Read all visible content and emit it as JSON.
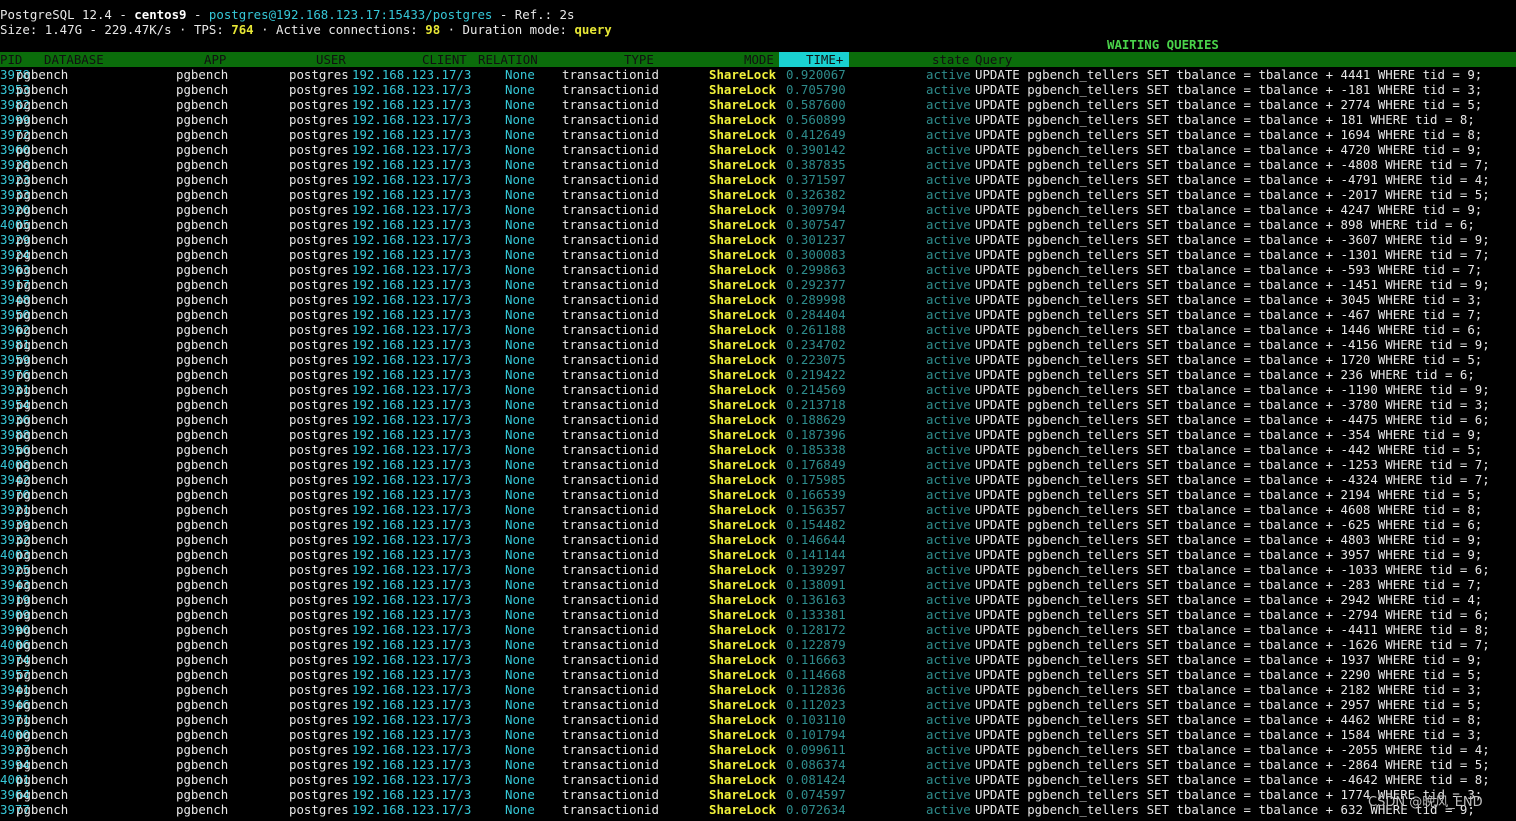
{
  "status": {
    "line1": {
      "version": "PostgreSQL 12.4",
      "sep1": " - ",
      "host": "centos9",
      "sep2": " - ",
      "conn": "postgres@192.168.123.17:15433/postgres",
      "sep3": " - ",
      "refresh": "Ref.: 2s"
    },
    "line2": {
      "size": "Size: 1.47G - 229.47K/s · TPS: ",
      "tps": "764",
      "active_lbl": " · Active connections: ",
      "active": "98",
      "dur_lbl": " · Duration mode: ",
      "dur": "query"
    }
  },
  "section_title": "WAITING QUERIES",
  "columns": {
    "pid": "PID",
    "database": "DATABASE",
    "app": "APP",
    "user": "USER",
    "client": "CLIENT",
    "relation": "RELATION",
    "type": "TYPE",
    "mode": "MODE",
    "time": "TIME+",
    "state": "state",
    "query": "Query"
  },
  "rows": [
    {
      "pid": "3978",
      "db": "pgbench",
      "app": "pgbench",
      "user": "postgres",
      "client": "192.168.123.17/3",
      "rel": "None",
      "type": "transactionid",
      "mode": "ShareLock",
      "time": "0.920067",
      "state": "active",
      "query": "UPDATE pgbench_tellers SET tbalance = tbalance + 4441 WHERE tid = 9;"
    },
    {
      "pid": "3953",
      "db": "pgbench",
      "app": "pgbench",
      "user": "postgres",
      "client": "192.168.123.17/3",
      "rel": "None",
      "type": "transactionid",
      "mode": "ShareLock",
      "time": "0.705790",
      "state": "active",
      "query": "UPDATE pgbench_tellers SET tbalance = tbalance + -181 WHERE tid = 3;"
    },
    {
      "pid": "3982",
      "db": "pgbench",
      "app": "pgbench",
      "user": "postgres",
      "client": "192.168.123.17/3",
      "rel": "None",
      "type": "transactionid",
      "mode": "ShareLock",
      "time": "0.587600",
      "state": "active",
      "query": "UPDATE pgbench_tellers SET tbalance = tbalance + 2774 WHERE tid = 5;"
    },
    {
      "pid": "3999",
      "db": "pgbench",
      "app": "pgbench",
      "user": "postgres",
      "client": "192.168.123.17/3",
      "rel": "None",
      "type": "transactionid",
      "mode": "ShareLock",
      "time": "0.560899",
      "state": "active",
      "query": "UPDATE pgbench_tellers SET tbalance = tbalance + 181 WHERE tid = 8;"
    },
    {
      "pid": "3972",
      "db": "pgbench",
      "app": "pgbench",
      "user": "postgres",
      "client": "192.168.123.17/3",
      "rel": "None",
      "type": "transactionid",
      "mode": "ShareLock",
      "time": "0.412649",
      "state": "active",
      "query": "UPDATE pgbench_tellers SET tbalance = tbalance + 1694 WHERE tid = 8;"
    },
    {
      "pid": "3960",
      "db": "pgbench",
      "app": "pgbench",
      "user": "postgres",
      "client": "192.168.123.17/3",
      "rel": "None",
      "type": "transactionid",
      "mode": "ShareLock",
      "time": "0.390142",
      "state": "active",
      "query": "UPDATE pgbench_tellers SET tbalance = tbalance + 4720 WHERE tid = 9;"
    },
    {
      "pid": "3928",
      "db": "pgbench",
      "app": "pgbench",
      "user": "postgres",
      "client": "192.168.123.17/3",
      "rel": "None",
      "type": "transactionid",
      "mode": "ShareLock",
      "time": "0.387835",
      "state": "active",
      "query": "UPDATE pgbench_tellers SET tbalance = tbalance + -4808 WHERE tid = 7;"
    },
    {
      "pid": "3923",
      "db": "pgbench",
      "app": "pgbench",
      "user": "postgres",
      "client": "192.168.123.17/3",
      "rel": "None",
      "type": "transactionid",
      "mode": "ShareLock",
      "time": "0.371597",
      "state": "active",
      "query": "UPDATE pgbench_tellers SET tbalance = tbalance + -4791 WHERE tid = 4;"
    },
    {
      "pid": "3933",
      "db": "pgbench",
      "app": "pgbench",
      "user": "postgres",
      "client": "192.168.123.17/3",
      "rel": "None",
      "type": "transactionid",
      "mode": "ShareLock",
      "time": "0.326382",
      "state": "active",
      "query": "UPDATE pgbench_tellers SET tbalance = tbalance + -2017 WHERE tid = 5;"
    },
    {
      "pid": "3920",
      "db": "pgbench",
      "app": "pgbench",
      "user": "postgres",
      "client": "192.168.123.17/3",
      "rel": "None",
      "type": "transactionid",
      "mode": "ShareLock",
      "time": "0.309794",
      "state": "active",
      "query": "UPDATE pgbench_tellers SET tbalance = tbalance + 4247 WHERE tid = 9;"
    },
    {
      "pid": "4005",
      "db": "pgbench",
      "app": "pgbench",
      "user": "postgres",
      "client": "192.168.123.17/3",
      "rel": "None",
      "type": "transactionid",
      "mode": "ShareLock",
      "time": "0.307547",
      "state": "active",
      "query": "UPDATE pgbench_tellers SET tbalance = tbalance + 898 WHERE tid = 6;"
    },
    {
      "pid": "3929",
      "db": "pgbench",
      "app": "pgbench",
      "user": "postgres",
      "client": "192.168.123.17/3",
      "rel": "None",
      "type": "transactionid",
      "mode": "ShareLock",
      "time": "0.301237",
      "state": "active",
      "query": "UPDATE pgbench_tellers SET tbalance = tbalance + -3607 WHERE tid = 9;"
    },
    {
      "pid": "3924",
      "db": "pgbench",
      "app": "pgbench",
      "user": "postgres",
      "client": "192.168.123.17/3",
      "rel": "None",
      "type": "transactionid",
      "mode": "ShareLock",
      "time": "0.300083",
      "state": "active",
      "query": "UPDATE pgbench_tellers SET tbalance = tbalance + -1301 WHERE tid = 7;"
    },
    {
      "pid": "3963",
      "db": "pgbench",
      "app": "pgbench",
      "user": "postgres",
      "client": "192.168.123.17/3",
      "rel": "None",
      "type": "transactionid",
      "mode": "ShareLock",
      "time": "0.299863",
      "state": "active",
      "query": "UPDATE pgbench_tellers SET tbalance = tbalance + -593 WHERE tid = 7;"
    },
    {
      "pid": "3917",
      "db": "pgbench",
      "app": "pgbench",
      "user": "postgres",
      "client": "192.168.123.17/3",
      "rel": "None",
      "type": "transactionid",
      "mode": "ShareLock",
      "time": "0.292377",
      "state": "active",
      "query": "UPDATE pgbench_tellers SET tbalance = tbalance + -1451 WHERE tid = 9;"
    },
    {
      "pid": "3948",
      "db": "pgbench",
      "app": "pgbench",
      "user": "postgres",
      "client": "192.168.123.17/3",
      "rel": "None",
      "type": "transactionid",
      "mode": "ShareLock",
      "time": "0.289998",
      "state": "active",
      "query": "UPDATE pgbench_tellers SET tbalance = tbalance + 3045 WHERE tid = 3;"
    },
    {
      "pid": "3950",
      "db": "pgbench",
      "app": "pgbench",
      "user": "postgres",
      "client": "192.168.123.17/3",
      "rel": "None",
      "type": "transactionid",
      "mode": "ShareLock",
      "time": "0.284404",
      "state": "active",
      "query": "UPDATE pgbench_tellers SET tbalance = tbalance + -467 WHERE tid = 7;"
    },
    {
      "pid": "3962",
      "db": "pgbench",
      "app": "pgbench",
      "user": "postgres",
      "client": "192.168.123.17/3",
      "rel": "None",
      "type": "transactionid",
      "mode": "ShareLock",
      "time": "0.261188",
      "state": "active",
      "query": "UPDATE pgbench_tellers SET tbalance = tbalance + 1446 WHERE tid = 6;"
    },
    {
      "pid": "3981",
      "db": "pgbench",
      "app": "pgbench",
      "user": "postgres",
      "client": "192.168.123.17/3",
      "rel": "None",
      "type": "transactionid",
      "mode": "ShareLock",
      "time": "0.234702",
      "state": "active",
      "query": "UPDATE pgbench_tellers SET tbalance = tbalance + -4156 WHERE tid = 9;"
    },
    {
      "pid": "3959",
      "db": "pgbench",
      "app": "pgbench",
      "user": "postgres",
      "client": "192.168.123.17/3",
      "rel": "None",
      "type": "transactionid",
      "mode": "ShareLock",
      "time": "0.223075",
      "state": "active",
      "query": "UPDATE pgbench_tellers SET tbalance = tbalance + 1720 WHERE tid = 5;"
    },
    {
      "pid": "3976",
      "db": "pgbench",
      "app": "pgbench",
      "user": "postgres",
      "client": "192.168.123.17/3",
      "rel": "None",
      "type": "transactionid",
      "mode": "ShareLock",
      "time": "0.219422",
      "state": "active",
      "query": "UPDATE pgbench_tellers SET tbalance = tbalance + 236 WHERE tid = 6;"
    },
    {
      "pid": "3931",
      "db": "pgbench",
      "app": "pgbench",
      "user": "postgres",
      "client": "192.168.123.17/3",
      "rel": "None",
      "type": "transactionid",
      "mode": "ShareLock",
      "time": "0.214569",
      "state": "active",
      "query": "UPDATE pgbench_tellers SET tbalance = tbalance + -1190 WHERE tid = 9;"
    },
    {
      "pid": "3954",
      "db": "pgbench",
      "app": "pgbench",
      "user": "postgres",
      "client": "192.168.123.17/3",
      "rel": "None",
      "type": "transactionid",
      "mode": "ShareLock",
      "time": "0.213718",
      "state": "active",
      "query": "UPDATE pgbench_tellers SET tbalance = tbalance + -3780 WHERE tid = 3;"
    },
    {
      "pid": "3936",
      "db": "pgbench",
      "app": "pgbench",
      "user": "postgres",
      "client": "192.168.123.17/3",
      "rel": "None",
      "type": "transactionid",
      "mode": "ShareLock",
      "time": "0.188629",
      "state": "active",
      "query": "UPDATE pgbench_tellers SET tbalance = tbalance + -4475 WHERE tid = 6;"
    },
    {
      "pid": "3988",
      "db": "pgbench",
      "app": "pgbench",
      "user": "postgres",
      "client": "192.168.123.17/3",
      "rel": "None",
      "type": "transactionid",
      "mode": "ShareLock",
      "time": "0.187396",
      "state": "active",
      "query": "UPDATE pgbench_tellers SET tbalance = tbalance + -354 WHERE tid = 9;"
    },
    {
      "pid": "3956",
      "db": "pgbench",
      "app": "pgbench",
      "user": "postgres",
      "client": "192.168.123.17/3",
      "rel": "None",
      "type": "transactionid",
      "mode": "ShareLock",
      "time": "0.185338",
      "state": "active",
      "query": "UPDATE pgbench_tellers SET tbalance = tbalance + -442 WHERE tid = 5;"
    },
    {
      "pid": "4008",
      "db": "pgbench",
      "app": "pgbench",
      "user": "postgres",
      "client": "192.168.123.17/3",
      "rel": "None",
      "type": "transactionid",
      "mode": "ShareLock",
      "time": "0.176849",
      "state": "active",
      "query": "UPDATE pgbench_tellers SET tbalance = tbalance + -1253 WHERE tid = 7;"
    },
    {
      "pid": "3942",
      "db": "pgbench",
      "app": "pgbench",
      "user": "postgres",
      "client": "192.168.123.17/3",
      "rel": "None",
      "type": "transactionid",
      "mode": "ShareLock",
      "time": "0.175985",
      "state": "active",
      "query": "UPDATE pgbench_tellers SET tbalance = tbalance + -4324 WHERE tid = 7;"
    },
    {
      "pid": "3970",
      "db": "pgbench",
      "app": "pgbench",
      "user": "postgres",
      "client": "192.168.123.17/3",
      "rel": "None",
      "type": "transactionid",
      "mode": "ShareLock",
      "time": "0.166539",
      "state": "active",
      "query": "UPDATE pgbench_tellers SET tbalance = tbalance + 2194 WHERE tid = 5;"
    },
    {
      "pid": "3921",
      "db": "pgbench",
      "app": "pgbench",
      "user": "postgres",
      "client": "192.168.123.17/3",
      "rel": "None",
      "type": "transactionid",
      "mode": "ShareLock",
      "time": "0.156357",
      "state": "active",
      "query": "UPDATE pgbench_tellers SET tbalance = tbalance + 4608 WHERE tid = 8;"
    },
    {
      "pid": "3939",
      "db": "pgbench",
      "app": "pgbench",
      "user": "postgres",
      "client": "192.168.123.17/3",
      "rel": "None",
      "type": "transactionid",
      "mode": "ShareLock",
      "time": "0.154482",
      "state": "active",
      "query": "UPDATE pgbench_tellers SET tbalance = tbalance + -625 WHERE tid = 6;"
    },
    {
      "pid": "3932",
      "db": "pgbench",
      "app": "pgbench",
      "user": "postgres",
      "client": "192.168.123.17/3",
      "rel": "None",
      "type": "transactionid",
      "mode": "ShareLock",
      "time": "0.146644",
      "state": "active",
      "query": "UPDATE pgbench_tellers SET tbalance = tbalance + 4803 WHERE tid = 9;"
    },
    {
      "pid": "4003",
      "db": "pgbench",
      "app": "pgbench",
      "user": "postgres",
      "client": "192.168.123.17/3",
      "rel": "None",
      "type": "transactionid",
      "mode": "ShareLock",
      "time": "0.141144",
      "state": "active",
      "query": "UPDATE pgbench_tellers SET tbalance = tbalance + 3957 WHERE tid = 9;"
    },
    {
      "pid": "3925",
      "db": "pgbench",
      "app": "pgbench",
      "user": "postgres",
      "client": "192.168.123.17/3",
      "rel": "None",
      "type": "transactionid",
      "mode": "ShareLock",
      "time": "0.139297",
      "state": "active",
      "query": "UPDATE pgbench_tellers SET tbalance = tbalance + -1033 WHERE tid = 6;"
    },
    {
      "pid": "3943",
      "db": "pgbench",
      "app": "pgbench",
      "user": "postgres",
      "client": "192.168.123.17/3",
      "rel": "None",
      "type": "transactionid",
      "mode": "ShareLock",
      "time": "0.138091",
      "state": "active",
      "query": "UPDATE pgbench_tellers SET tbalance = tbalance + -283 WHERE tid = 7;"
    },
    {
      "pid": "3919",
      "db": "pgbench",
      "app": "pgbench",
      "user": "postgres",
      "client": "192.168.123.17/3",
      "rel": "None",
      "type": "transactionid",
      "mode": "ShareLock",
      "time": "0.136163",
      "state": "active",
      "query": "UPDATE pgbench_tellers SET tbalance = tbalance + 2942 WHERE tid = 4;"
    },
    {
      "pid": "3909",
      "db": "pgbench",
      "app": "pgbench",
      "user": "postgres",
      "client": "192.168.123.17/3",
      "rel": "None",
      "type": "transactionid",
      "mode": "ShareLock",
      "time": "0.133381",
      "state": "active",
      "query": "UPDATE pgbench_tellers SET tbalance = tbalance + -2794 WHERE tid = 6;"
    },
    {
      "pid": "3990",
      "db": "pgbench",
      "app": "pgbench",
      "user": "postgres",
      "client": "192.168.123.17/3",
      "rel": "None",
      "type": "transactionid",
      "mode": "ShareLock",
      "time": "0.128172",
      "state": "active",
      "query": "UPDATE pgbench_tellers SET tbalance = tbalance + -4411 WHERE tid = 8;"
    },
    {
      "pid": "4006",
      "db": "pgbench",
      "app": "pgbench",
      "user": "postgres",
      "client": "192.168.123.17/3",
      "rel": "None",
      "type": "transactionid",
      "mode": "ShareLock",
      "time": "0.122879",
      "state": "active",
      "query": "UPDATE pgbench_tellers SET tbalance = tbalance + -1626 WHERE tid = 7;"
    },
    {
      "pid": "3974",
      "db": "pgbench",
      "app": "pgbench",
      "user": "postgres",
      "client": "192.168.123.17/3",
      "rel": "None",
      "type": "transactionid",
      "mode": "ShareLock",
      "time": "0.116663",
      "state": "active",
      "query": "UPDATE pgbench_tellers SET tbalance = tbalance + 1937 WHERE tid = 9;"
    },
    {
      "pid": "3957",
      "db": "pgbench",
      "app": "pgbench",
      "user": "postgres",
      "client": "192.168.123.17/3",
      "rel": "None",
      "type": "transactionid",
      "mode": "ShareLock",
      "time": "0.114668",
      "state": "active",
      "query": "UPDATE pgbench_tellers SET tbalance = tbalance + 2290 WHERE tid = 5;"
    },
    {
      "pid": "3941",
      "db": "pgbench",
      "app": "pgbench",
      "user": "postgres",
      "client": "192.168.123.17/3",
      "rel": "None",
      "type": "transactionid",
      "mode": "ShareLock",
      "time": "0.112836",
      "state": "active",
      "query": "UPDATE pgbench_tellers SET tbalance = tbalance + 2182 WHERE tid = 3;"
    },
    {
      "pid": "3946",
      "db": "pgbench",
      "app": "pgbench",
      "user": "postgres",
      "client": "192.168.123.17/3",
      "rel": "None",
      "type": "transactionid",
      "mode": "ShareLock",
      "time": "0.112023",
      "state": "active",
      "query": "UPDATE pgbench_tellers SET tbalance = tbalance + 2957 WHERE tid = 5;"
    },
    {
      "pid": "3971",
      "db": "pgbench",
      "app": "pgbench",
      "user": "postgres",
      "client": "192.168.123.17/3",
      "rel": "None",
      "type": "transactionid",
      "mode": "ShareLock",
      "time": "0.103110",
      "state": "active",
      "query": "UPDATE pgbench_tellers SET tbalance = tbalance + 4462 WHERE tid = 8;"
    },
    {
      "pid": "4000",
      "db": "pgbench",
      "app": "pgbench",
      "user": "postgres",
      "client": "192.168.123.17/3",
      "rel": "None",
      "type": "transactionid",
      "mode": "ShareLock",
      "time": "0.101794",
      "state": "active",
      "query": "UPDATE pgbench_tellers SET tbalance = tbalance + 1584 WHERE tid = 3;"
    },
    {
      "pid": "3927",
      "db": "pgbench",
      "app": "pgbench",
      "user": "postgres",
      "client": "192.168.123.17/3",
      "rel": "None",
      "type": "transactionid",
      "mode": "ShareLock",
      "time": "0.099611",
      "state": "active",
      "query": "UPDATE pgbench_tellers SET tbalance = tbalance + -2055 WHERE tid = 4;"
    },
    {
      "pid": "3994",
      "db": "pgbench",
      "app": "pgbench",
      "user": "postgres",
      "client": "192.168.123.17/3",
      "rel": "None",
      "type": "transactionid",
      "mode": "ShareLock",
      "time": "0.086374",
      "state": "active",
      "query": "UPDATE pgbench_tellers SET tbalance = tbalance + -2864 WHERE tid = 5;"
    },
    {
      "pid": "4001",
      "db": "pgbench",
      "app": "pgbench",
      "user": "postgres",
      "client": "192.168.123.17/3",
      "rel": "None",
      "type": "transactionid",
      "mode": "ShareLock",
      "time": "0.081424",
      "state": "active",
      "query": "UPDATE pgbench_tellers SET tbalance = tbalance + -4642 WHERE tid = 8;"
    },
    {
      "pid": "3964",
      "db": "pgbench",
      "app": "pgbench",
      "user": "postgres",
      "client": "192.168.123.17/3",
      "rel": "None",
      "type": "transactionid",
      "mode": "ShareLock",
      "time": "0.074597",
      "state": "active",
      "query": "UPDATE pgbench_tellers SET tbalance = tbalance + 1774 WHERE tid = 3;"
    },
    {
      "pid": "3977",
      "db": "pgbench",
      "app": "pgbench",
      "user": "postgres",
      "client": "192.168.123.17/3",
      "rel": "None",
      "type": "transactionid",
      "mode": "ShareLock",
      "time": "0.072634",
      "state": "active",
      "query": "UPDATE pgbench_tellers SET tbalance = tbalance + 632 WHERE tid = 9;"
    }
  ],
  "watermark": "CSDN @晚风_END",
  "colors": {
    "background": "#000000",
    "header_bar": "#0b6d0b",
    "time_header": "#1ad1d1",
    "cyan": "#36c8d8",
    "mode_yellow": "#f2f23a",
    "dim_teal": "#2e8c8c",
    "section_green": "#4ad34a"
  }
}
